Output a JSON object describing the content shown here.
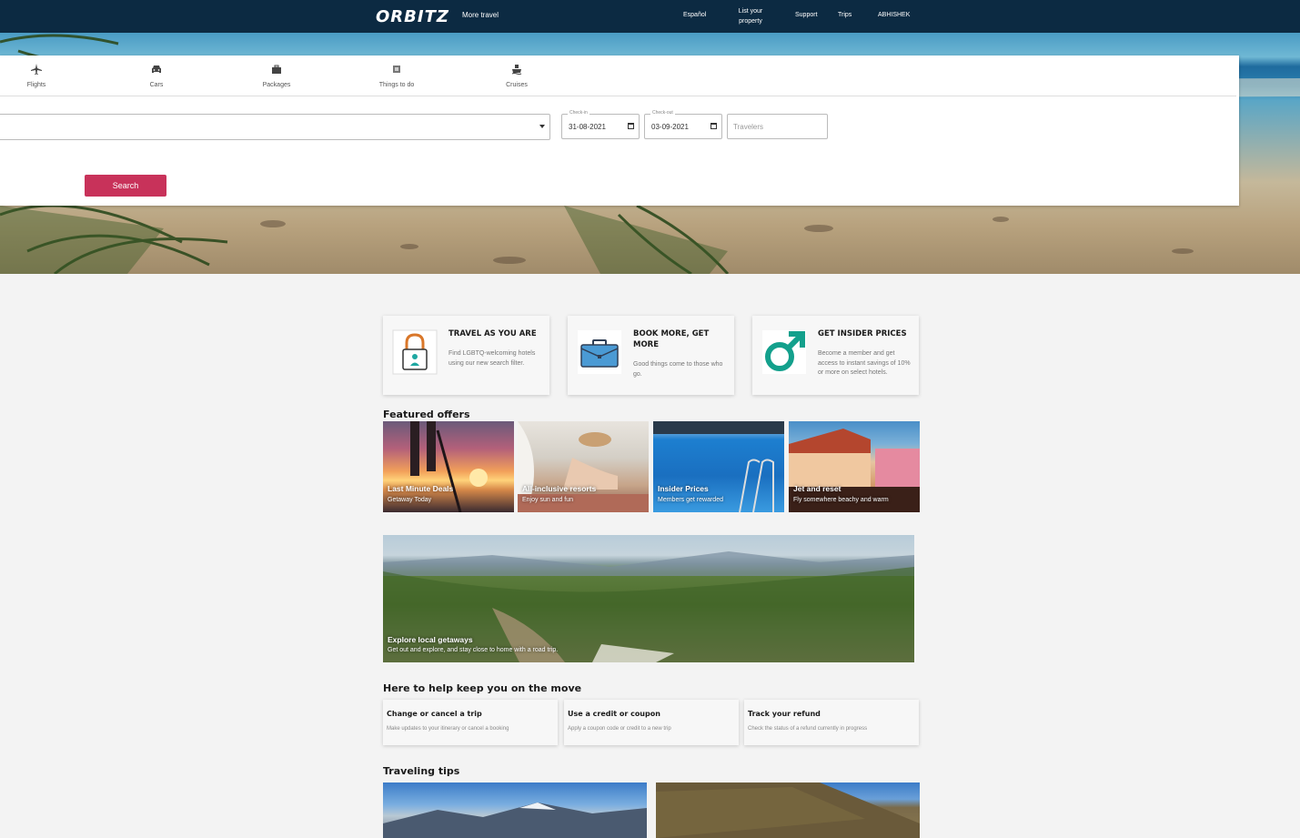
{
  "nav": {
    "logo": "ORBITZ",
    "more_travel": "More travel",
    "links": [
      "Español",
      "List your property",
      "Support",
      "Trips",
      "ABHISHEK"
    ]
  },
  "tabs": [
    {
      "label": "Flights",
      "icon": "airplane-icon"
    },
    {
      "label": "Cars",
      "icon": "car-icon"
    },
    {
      "label": "Packages",
      "icon": "briefcase-icon"
    },
    {
      "label": "Things to do",
      "icon": "ticket-icon"
    },
    {
      "label": "Cruises",
      "icon": "ship-icon"
    }
  ],
  "search": {
    "destination_value": "",
    "checkin_label": "Check-in",
    "checkin_value": "31-08-2021",
    "checkout_label": "Check-out",
    "checkout_value": "03-09-2021",
    "travelers_placeholder": "Travelers",
    "button": "Search"
  },
  "promos": [
    {
      "title": "TRAVEL AS YOU ARE",
      "desc": "Find LGBTQ-welcoming hotels using our new search filter.",
      "icon": "lock-icon"
    },
    {
      "title": "BOOK MORE, GET MORE",
      "desc": "Good things come to those who go.",
      "icon": "suitcase-icon"
    },
    {
      "title": "GET INSIDER PRICES",
      "desc": "Become a member and get access to instant savings of 10% or more on select hotels.",
      "icon": "male-symbol-icon"
    }
  ],
  "featured": {
    "title": "Featured offers",
    "offers": [
      {
        "title": "Last Minute Deals",
        "subtitle": "Getaway Today"
      },
      {
        "title": "All-inclusive resorts",
        "subtitle": "Enjoy sun and fun"
      },
      {
        "title": "Insider Prices",
        "subtitle": "Members get rewarded"
      },
      {
        "title": "Jet and reset",
        "subtitle": "Fly somewhere beachy and warm"
      }
    ]
  },
  "explore": {
    "title": "Explore local getaways",
    "subtitle": "Get out and explore, and stay close to home with a road trip."
  },
  "help": {
    "title": "Here to help keep you on the move",
    "cards": [
      {
        "title": "Change or cancel a trip",
        "desc": "Make updates to your itinerary or cancel a booking"
      },
      {
        "title": "Use a credit or coupon",
        "desc": "Apply a coupon code or credit to a new trip"
      },
      {
        "title": "Track your refund",
        "desc": "Check the status of a refund currently in progress"
      }
    ]
  },
  "tips": {
    "title": "Traveling tips"
  },
  "colors": {
    "nav_bg": "#0c2a42",
    "search_button": "#c8325a",
    "page_bg": "#f3f3f3"
  }
}
